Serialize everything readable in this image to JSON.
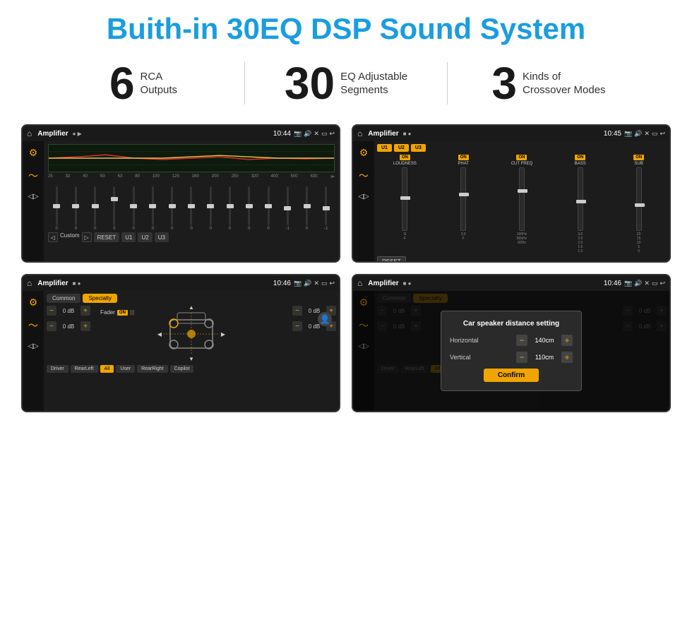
{
  "header": {
    "title": "Buith-in 30EQ DSP Sound System"
  },
  "stats": [
    {
      "number": "6",
      "label": "RCA\nOutputs"
    },
    {
      "number": "30",
      "label": "EQ Adjustable\nSegments"
    },
    {
      "number": "3",
      "label": "Kinds of\nCrossover Modes"
    }
  ],
  "screens": {
    "screen1": {
      "status": {
        "app": "Amplifier",
        "time": "10:44"
      },
      "eq_freqs": [
        "25",
        "32",
        "40",
        "50",
        "63",
        "80",
        "100",
        "125",
        "160",
        "200",
        "250",
        "320",
        "400",
        "500",
        "630"
      ],
      "eq_values": [
        "0",
        "0",
        "0",
        "5",
        "0",
        "0",
        "0",
        "0",
        "0",
        "0",
        "0",
        "0",
        "-1",
        "0",
        "-1"
      ],
      "preset": "Custom",
      "buttons": [
        "RESET",
        "U1",
        "U2",
        "U3"
      ]
    },
    "screen2": {
      "status": {
        "app": "Amplifier",
        "time": "10:45"
      },
      "presets": [
        "U1",
        "U2",
        "U3"
      ],
      "bands": [
        {
          "on": "ON",
          "name": "LOUDNESS"
        },
        {
          "on": "ON",
          "name": "PHAT"
        },
        {
          "on": "ON",
          "name": "CUT FREQ"
        },
        {
          "on": "ON",
          "name": "BASS"
        },
        {
          "on": "ON",
          "name": "SUB"
        }
      ],
      "reset": "RESET"
    },
    "screen3": {
      "status": {
        "app": "Amplifier",
        "time": "10:46"
      },
      "tabs": [
        "Common",
        "Specialty"
      ],
      "fader_label": "Fader",
      "fader_on": "ON",
      "controls": [
        {
          "label": "0 dB",
          "minus": "−",
          "plus": "+"
        },
        {
          "label": "0 dB",
          "minus": "−",
          "plus": "+"
        },
        {
          "label": "0 dB",
          "minus": "−",
          "plus": "+"
        },
        {
          "label": "0 dB",
          "minus": "−",
          "plus": "+"
        }
      ],
      "bottom_buttons": [
        "Driver",
        "RearLeft",
        "All",
        "User",
        "RearRight",
        "Copilot"
      ]
    },
    "screen4": {
      "status": {
        "app": "Amplifier",
        "time": "10:46"
      },
      "tabs": [
        "Common",
        "Specialty"
      ],
      "dialog": {
        "title": "Car speaker distance setting",
        "horizontal_label": "Horizontal",
        "horizontal_value": "140cm",
        "vertical_label": "Vertical",
        "vertical_value": "110cm",
        "confirm": "Confirm"
      },
      "bottom_buttons": [
        "Driver",
        "RearLeft",
        "All",
        "User",
        "RearRight",
        "Copilot"
      ]
    }
  }
}
